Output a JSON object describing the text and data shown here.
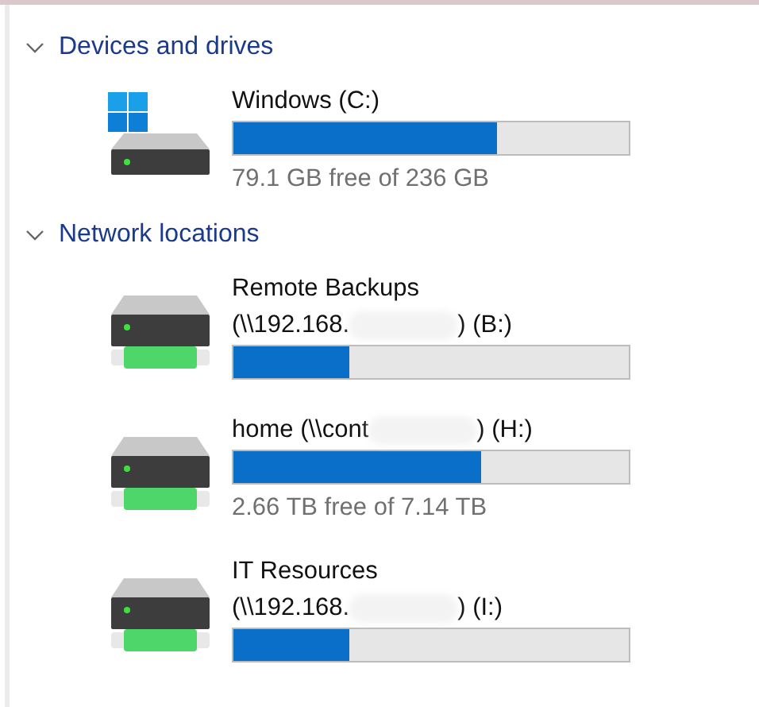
{
  "sections": [
    {
      "title": "Devices and drives",
      "expanded": true,
      "drives": [
        {
          "kind": "system",
          "name_lines": [
            [
              {
                "kind": "text",
                "text": "Windows (C:)"
              }
            ]
          ],
          "level": 0.665,
          "free": "79.1 GB free of 236 GB"
        }
      ]
    },
    {
      "title": "Network locations",
      "expanded": true,
      "drives": [
        {
          "kind": "network",
          "name_lines": [
            [
              {
                "kind": "text",
                "text": "Remote Backups"
              }
            ],
            [
              {
                "kind": "text",
                "text": "(\\\\192.168."
              },
              {
                "kind": "redacted"
              },
              {
                "kind": "text",
                "text": ") (B:)"
              }
            ]
          ],
          "level": 0.295
        },
        {
          "kind": "network",
          "name_lines": [
            [
              {
                "kind": "text",
                "text": "home (\\\\cont"
              },
              {
                "kind": "redacted"
              },
              {
                "kind": "text",
                "text": ") (H:)"
              }
            ]
          ],
          "level": 0.625,
          "free": "2.66 TB free of 7.14 TB"
        },
        {
          "kind": "network",
          "name_lines": [
            [
              {
                "kind": "text",
                "text": "IT Resources"
              }
            ],
            [
              {
                "kind": "text",
                "text": "(\\\\192.168."
              },
              {
                "kind": "redacted"
              },
              {
                "kind": "text",
                "text": ") (I:)"
              }
            ]
          ],
          "level": 0.295
        }
      ]
    }
  ]
}
